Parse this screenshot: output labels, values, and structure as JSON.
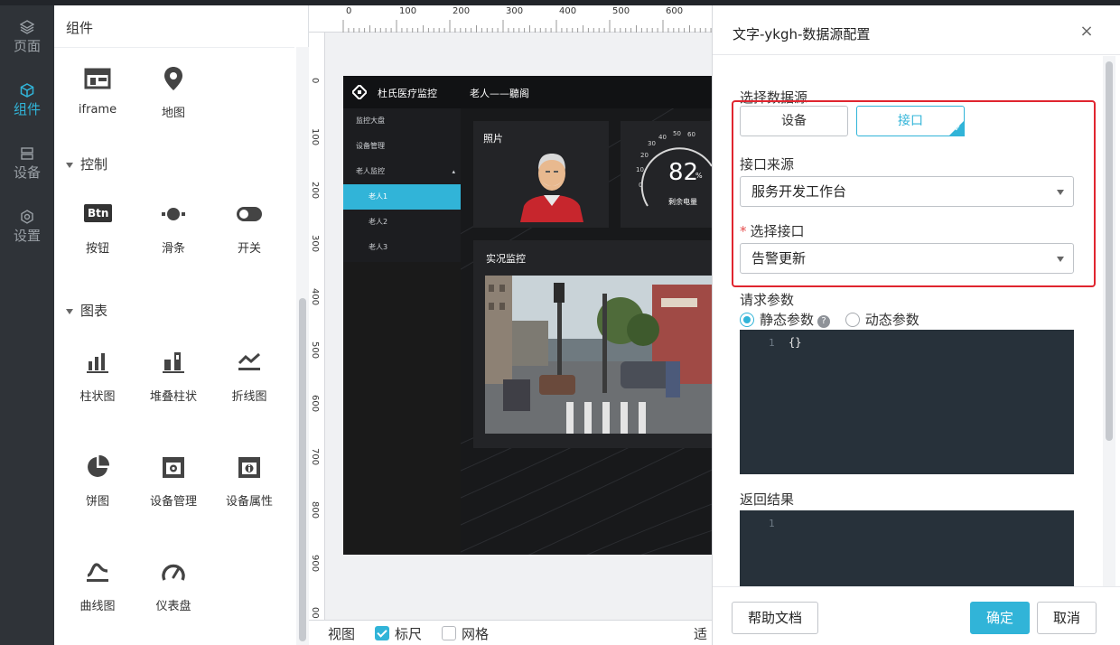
{
  "nav": [
    {
      "label": "页面",
      "icon": "layers-icon"
    },
    {
      "label": "组件",
      "icon": "cube-icon"
    },
    {
      "label": "设备",
      "icon": "server-icon"
    },
    {
      "label": "设置",
      "icon": "settings-icon"
    }
  ],
  "component_panel": {
    "title": "组件",
    "basic": [
      {
        "label": "iframe",
        "icon": "iframe-icon"
      },
      {
        "label": "地图",
        "icon": "map-pin-icon"
      }
    ],
    "groups": [
      {
        "title": "控制",
        "items": [
          {
            "label": "按钮",
            "glyph": "Btn",
            "icon": "button-icon"
          },
          {
            "label": "滑条",
            "icon": "slider-icon"
          },
          {
            "label": "开关",
            "icon": "toggle-icon"
          }
        ]
      },
      {
        "title": "图表",
        "items": [
          {
            "label": "柱状图",
            "icon": "bar-chart-icon"
          },
          {
            "label": "堆叠柱状",
            "icon": "stacked-bar-icon"
          },
          {
            "label": "折线图",
            "icon": "line-chart-icon"
          },
          {
            "label": "饼图",
            "icon": "pie-chart-icon"
          },
          {
            "label": "设备管理",
            "icon": "device-manage-icon"
          },
          {
            "label": "设备属性",
            "icon": "device-attr-icon"
          },
          {
            "label": "曲线图",
            "icon": "curve-chart-icon"
          },
          {
            "label": "仪表盘",
            "icon": "gauge-icon"
          }
        ]
      }
    ]
  },
  "canvas": {
    "ruler_h": [
      "0",
      "100",
      "200",
      "300",
      "400",
      "500",
      "600"
    ],
    "ruler_v": [
      "0",
      "100",
      "200",
      "300",
      "400",
      "500",
      "600",
      "700",
      "800",
      "900",
      "00"
    ],
    "bottom": {
      "view": "视图",
      "ruler": "标尺",
      "ruler_checked": true,
      "grid": "网格",
      "grid_checked": false,
      "fit": "适合"
    }
  },
  "dashboard": {
    "brand": "杜氏医疗监控",
    "title": "老人——聽阁",
    "menu": [
      {
        "label": "监控大盘"
      },
      {
        "label": "设备管理"
      },
      {
        "label": "老人监控",
        "expand": "▴"
      },
      {
        "label": "老人1",
        "selected": true
      },
      {
        "label": "老人2"
      },
      {
        "label": "老人3"
      }
    ],
    "photo_title": "照片",
    "gauge_value": "82",
    "gauge_unit": "%",
    "gauge_label": "剩余电量",
    "gauge_ticks": [
      "0",
      "10",
      "20",
      "30",
      "40",
      "50",
      "60"
    ],
    "live_title": "实况监控"
  },
  "dialog": {
    "title": "文字-ykgh-数据源配置",
    "close": "×",
    "source_label": "选择数据源",
    "source_options": [
      "设备",
      "接口"
    ],
    "source_selected": "接口",
    "api_source_label": "接口来源",
    "api_source_value": "服务开发工作台",
    "api_label": "选择接口",
    "api_required_mark": "*",
    "api_value": "告警更新",
    "params_label": "请求参数",
    "param_static": "静态参数",
    "param_dynamic": "动态参数",
    "param_selected": "静态参数",
    "help_mark": "?",
    "params_line_no": "1",
    "params_code": "{}",
    "result_label": "返回结果",
    "result_line_no": "1",
    "help_btn": "帮助文档",
    "ok_btn": "确定",
    "cancel_btn": "取消"
  },
  "colors": {
    "accent": "#31b4d8",
    "highlight": "#e0252f",
    "sidebar_bg": "#2f3338",
    "code_bg": "#27313a"
  }
}
